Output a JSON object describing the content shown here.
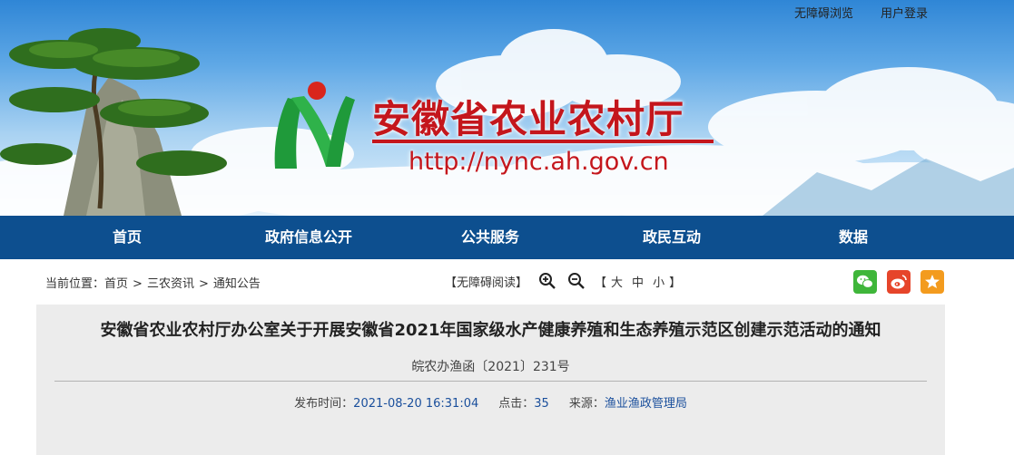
{
  "header": {
    "accessibility_link": "无障碍浏览",
    "login_link": "用户登录",
    "site_title": "安徽省农业农村厅",
    "site_url": "http://nync.ah.gov.cn"
  },
  "nav": {
    "items": [
      "首页",
      "政府信息公开",
      "公共服务",
      "政民互动",
      "数据"
    ]
  },
  "breadcrumb": {
    "prefix": "当前位置：",
    "items": [
      "首页",
      "三农资讯",
      "通知公告"
    ],
    "separator": ">"
  },
  "reading_tools": {
    "accessible_read": "【无障碍阅读】",
    "size_open": "【",
    "size_large": "大",
    "size_medium": "中",
    "size_small": "小",
    "size_close": "】"
  },
  "share": {
    "wechat_color": "#3fb63a",
    "weibo_color": "#e6452a",
    "favorite_color": "#f39b1e"
  },
  "article": {
    "title": "安徽省农业农村厅办公室关于开展安徽省2021年国家级水产健康养殖和生态养殖示范区创建示范活动的通知",
    "doc_number": "皖农办渔函〔2021〕231号",
    "publish_label": "发布时间：",
    "publish_time": "2021-08-20 16:31:04",
    "clicks_label": "点击：",
    "clicks": "35",
    "source_label": "来源：",
    "source": "渔业渔政管理局"
  },
  "colors": {
    "nav_background": "#0d4f8f",
    "title_red": "#c4161c",
    "article_background": "#ececec"
  }
}
